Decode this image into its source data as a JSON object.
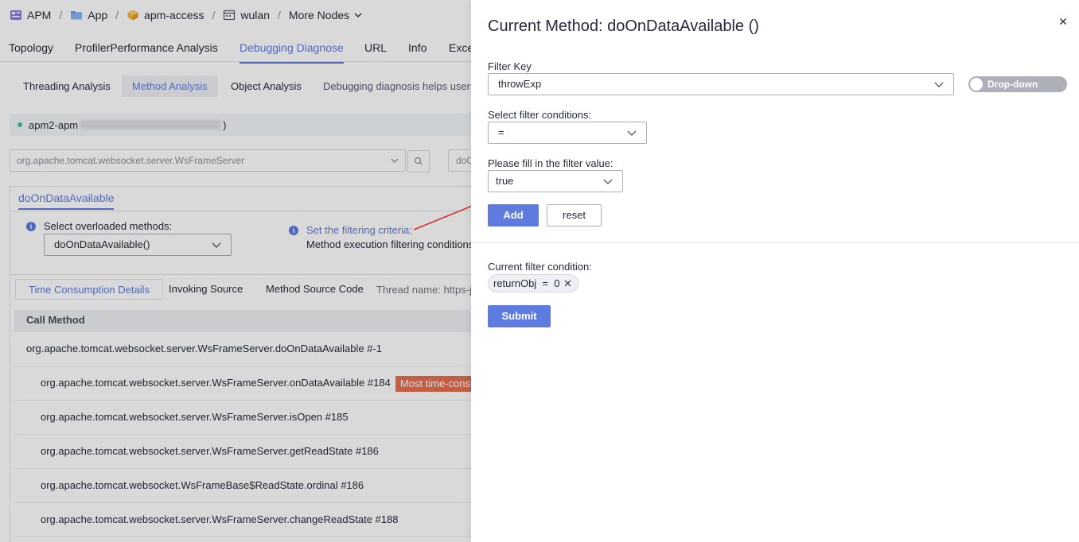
{
  "breadcrumb": {
    "items": [
      "APM",
      "App",
      "apm-access",
      "wulan",
      "More Nodes"
    ],
    "icons": [
      "apm-icon",
      "folder-icon",
      "cube-icon",
      "calendar-icon"
    ]
  },
  "main_tabs": [
    "Topology",
    "ProfilerPerformance Analysis",
    "Debugging Diagnose",
    "URL",
    "Info",
    "Exce"
  ],
  "sub_tabs": [
    "Threading Analysis",
    "Method Analysis",
    "Object Analysis"
  ],
  "sub_tab_description": "Debugging diagnosis helps users a",
  "instance": {
    "prefix": "apm2-apm",
    "suffix": ")"
  },
  "class_select_value": "org.apache.tomcat.websocket.server.WsFrameServer",
  "method_select_value": "doO",
  "method_tab": "doOnDataAvailable",
  "overload": {
    "label": "Select overloaded methods:",
    "value": "doOnDataAvailable()"
  },
  "criteria": {
    "link": "Set the filtering criteria:",
    "text": "Method execution filtering conditions ar"
  },
  "detail_tabs": [
    "Time Consumption Details",
    "Invoking Source",
    "Method Source Code"
  ],
  "thread_name": "Thread name: https-jss",
  "table": {
    "header": "Call Method",
    "rows": [
      {
        "text": "org.apache.tomcat.websocket.server.WsFrameServer.doOnDataAvailable #-1",
        "badge": ""
      },
      {
        "text": "org.apache.tomcat.websocket.server.WsFrameServer.onDataAvailable #184",
        "badge": "Most time-consuming"
      },
      {
        "text": "org.apache.tomcat.websocket.server.WsFrameServer.isOpen #185",
        "badge": ""
      },
      {
        "text": "org.apache.tomcat.websocket.server.WsFrameServer.getReadState #186",
        "badge": ""
      },
      {
        "text": "org.apache.tomcat.websocket.WsFrameBase$ReadState.ordinal #186",
        "badge": ""
      },
      {
        "text": "org.apache.tomcat.websocket.server.WsFrameServer.changeReadState #188",
        "badge": ""
      }
    ]
  },
  "drawer": {
    "title": "Current Method: doOnDataAvailable ()",
    "filter_key_label": "Filter Key",
    "filter_key_value": "throwExp",
    "toggle_label": "Drop-down",
    "conditions_label": "Select filter conditions:",
    "conditions_value": "=",
    "filter_value_label": "Please fill in the filter value:",
    "filter_value": "true",
    "add_label": "Add",
    "reset_label": "reset",
    "current_label": "Current filter condition:",
    "current_tag": "returnObj  =  0",
    "submit_label": "Submit"
  },
  "colors": {
    "accent": "#5e7ce0",
    "badge": "#e86e4f",
    "arrow": "#e02d2d"
  }
}
